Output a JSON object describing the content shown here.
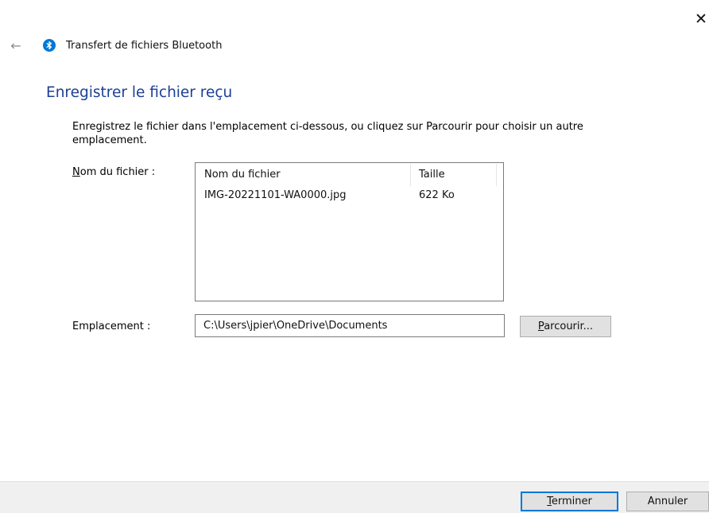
{
  "window": {
    "close_glyph": "✕",
    "back_glyph": "←"
  },
  "header": {
    "app_title": "Transfert de fichiers Bluetooth",
    "app_icon": "bluetooth-icon"
  },
  "page": {
    "heading": "Enregistrer le fichier reçu",
    "instructions": "Enregistrez le fichier dans l'emplacement ci-dessous, ou cliquez sur Parcourir pour choisir un autre emplacement."
  },
  "file_field": {
    "label_accel": "N",
    "label_rest": "om du fichier :",
    "columns": [
      "Nom du fichier",
      "Taille"
    ],
    "rows": [
      {
        "name": "IMG-20221101-WA0000.jpg",
        "size": "622 Ko"
      }
    ]
  },
  "location_field": {
    "label": "Emplacement :",
    "value": "C:\\Users\\jpier\\OneDrive\\Documents"
  },
  "buttons": {
    "browse_accel": "P",
    "browse_rest": "arcourir...",
    "finish_accel": "T",
    "finish_rest": "erminer",
    "cancel": "Annuler"
  },
  "colors": {
    "heading": "#1c3f94",
    "bluetooth": "#0078d7",
    "default_button_border": "#0078d7",
    "footer_bg": "#f0f0f0"
  }
}
